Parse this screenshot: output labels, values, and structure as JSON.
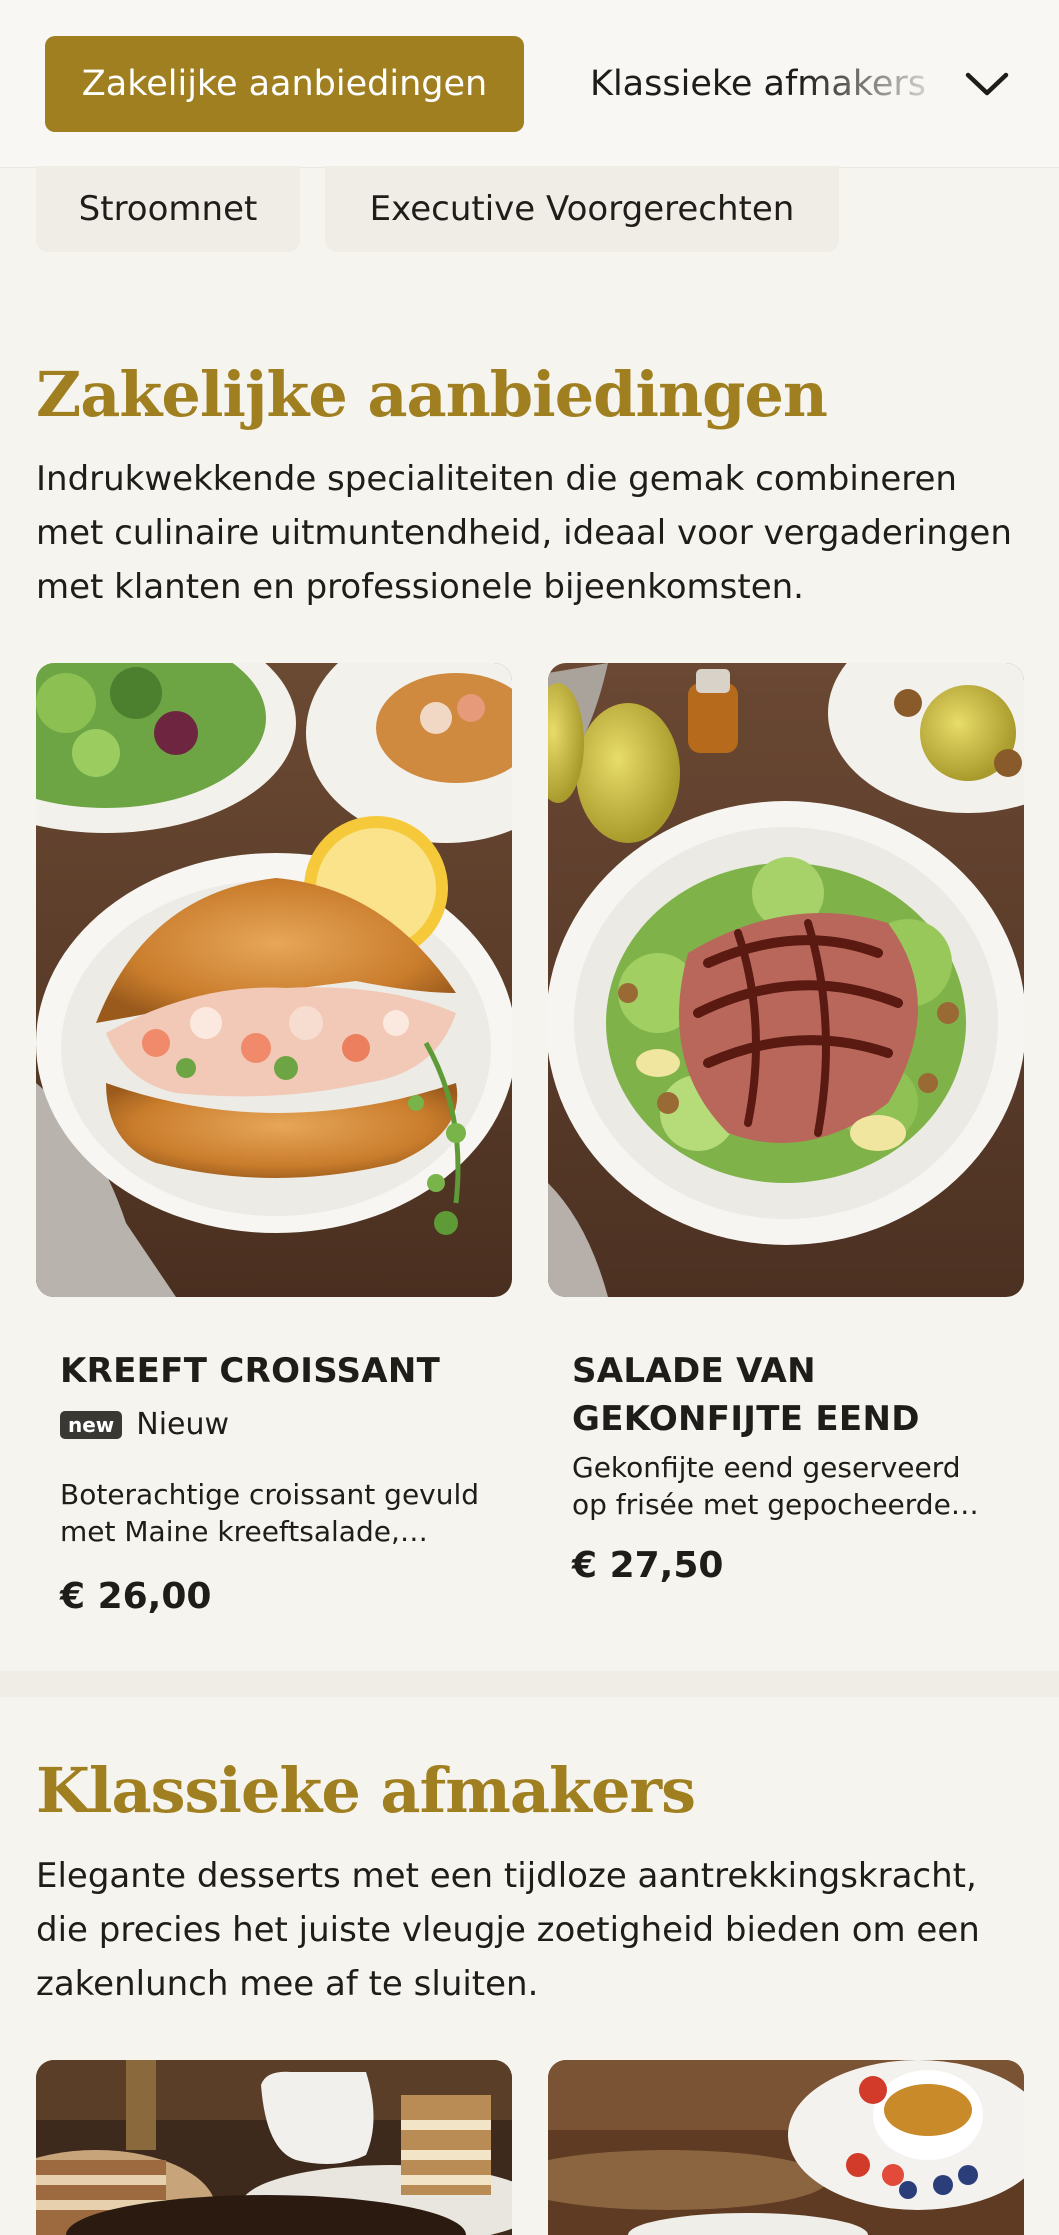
{
  "nav": {
    "active_tab": "Zakelijke aanbiedingen",
    "next_tab": "Klassieke afmakers",
    "expand_icon": "chevron-down-icon",
    "chips": [
      "Stroomnet",
      "Executive Voorgerechten"
    ]
  },
  "colors": {
    "accent": "#a07f21",
    "background": "#f6f4ee",
    "text": "#1f1d1a"
  },
  "sections": [
    {
      "title": "Zakelijke aanbiedingen",
      "description": "Indrukwekkende specialiteiten die gemak combineren met culinaire uitmuntendheid, ideaal voor vergaderingen met klanten en professionele bijeenkomsten.",
      "items": [
        {
          "title": "KREEFT CROISSANT",
          "badge": "new",
          "badge_label": "Nieuw",
          "description": "Boterachtige croissant gevuld met Maine kreeftsalade, citroen en verse kruiden",
          "price": "€ 26,00"
        },
        {
          "title": "SALADE VAN GEKONFIJTE EEND",
          "description": "Gekonfijte eend geserveerd op frisée met gepocheerde peer en walnoten",
          "price": "€ 27,50"
        }
      ]
    },
    {
      "title": "Klassieke afmakers",
      "description": "Elegante desserts met een tijdloze aantrekkingskracht, die precies het juiste vleugje zoetigheid bieden om een zakenlunch mee af te sluiten."
    }
  ]
}
